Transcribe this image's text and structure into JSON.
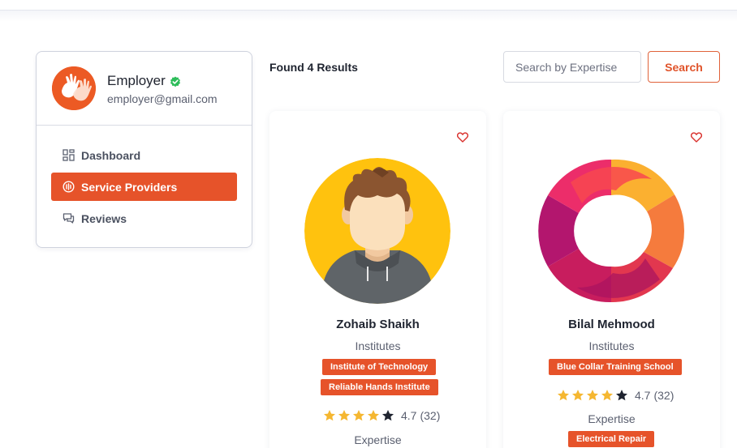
{
  "colors": {
    "accent": "#e6532a",
    "verified": "#2dbd5a",
    "star": "#f5b731",
    "star_empty": "#1f2430"
  },
  "sidebar": {
    "user": {
      "name": "Employer",
      "email": "employer@gmail.com",
      "avatar_icon": "hands-logo-icon",
      "verified_icon": "verified-check-icon"
    },
    "nav": [
      {
        "label": "Dashboard",
        "icon": "dashboard-grid-icon",
        "active": false
      },
      {
        "label": "Service Providers",
        "icon": "service-providers-icon",
        "active": true
      },
      {
        "label": "Reviews",
        "icon": "reviews-chat-icon",
        "active": false
      }
    ]
  },
  "main": {
    "results_text": "Found 4 Results",
    "search": {
      "placeholder": "Search by Expertise",
      "value": "",
      "button_label": "Search"
    }
  },
  "providers": [
    {
      "name": "Zohaib Shaikh",
      "category": "Institutes",
      "tags": [
        "Institute of Technology",
        "Reliable Hands Institute"
      ],
      "rating": "4.7",
      "review_count": "(32)",
      "stars_filled": 4,
      "stars_total": 5,
      "expertise_label": "Expertise",
      "expertise": [],
      "avatar_icon": "person-avatar-icon",
      "favorite_icon": "heart-icon"
    },
    {
      "name": "Bilal Mehmood",
      "category": "Institutes",
      "tags": [
        "Blue Collar Training School"
      ],
      "rating": "4.7",
      "review_count": "(32)",
      "stars_filled": 4,
      "stars_total": 5,
      "expertise_label": "Expertise",
      "expertise": [
        "Electrical Repair"
      ],
      "avatar_icon": "ring-logo-icon",
      "favorite_icon": "heart-icon"
    }
  ]
}
